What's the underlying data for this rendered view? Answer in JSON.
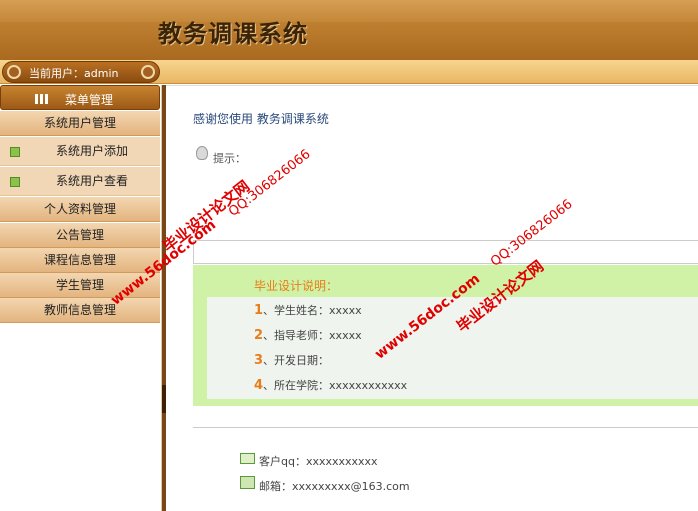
{
  "header": {
    "title": "教务调课系统"
  },
  "userbar": {
    "label": "当前用户：admin"
  },
  "sidebar": {
    "menu_title": "菜单管理",
    "items": [
      {
        "label": "系统用户管理"
      },
      {
        "label": "系统用户添加",
        "sub": true
      },
      {
        "label": "系统用户查看",
        "sub": true
      },
      {
        "label": "个人资料管理"
      },
      {
        "label": "公告管理"
      },
      {
        "label": "课程信息管理"
      },
      {
        "label": "学生管理"
      },
      {
        "label": "教师信息管理"
      }
    ]
  },
  "main": {
    "welcome": "感谢您使用 教务调课系统",
    "tip": "提示：",
    "info_title": "毕业设计说明：",
    "info_items": [
      {
        "num": "1",
        "text": "、学生姓名：xxxxx"
      },
      {
        "num": "2",
        "text": "、指导老师：xxxxx"
      },
      {
        "num": "3",
        "text": "、开发日期："
      },
      {
        "num": "4",
        "text": "、所在学院：xxxxxxxxxxxx"
      }
    ],
    "contact_qq": "客户qq：xxxxxxxxxxx",
    "contact_mail": "邮箱：xxxxxxxxx@163.com"
  },
  "watermarks": {
    "site": "www.56doc.com",
    "qq": "QQ:306826066",
    "brand": "毕业设计论文网"
  },
  "colors": {
    "header": "#b97a2c",
    "accent": "#e87d1b",
    "green_panel": "#cff2a6"
  }
}
